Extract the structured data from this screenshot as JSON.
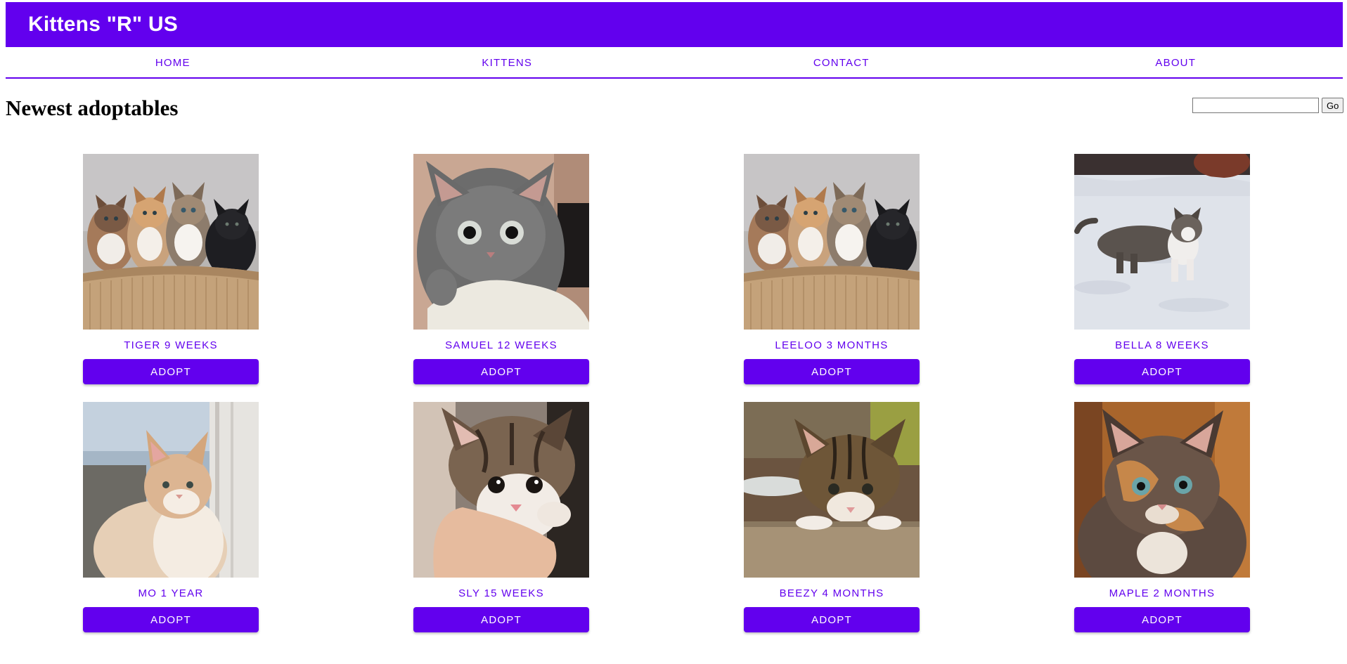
{
  "header": {
    "title": "Kittens \"R\" US",
    "color": "#6200ee"
  },
  "nav": {
    "tabs": [
      {
        "label": "HOME"
      },
      {
        "label": "KITTENS"
      },
      {
        "label": "CONTACT"
      },
      {
        "label": "ABOUT"
      }
    ]
  },
  "main": {
    "heading": "Newest adoptables"
  },
  "search": {
    "value": "",
    "placeholder": "",
    "button_label": "Go"
  },
  "kittens": [
    {
      "caption": "TIGER 9 WEEKS",
      "adopt_label": "ADOPT",
      "photo": "kittens-in-basket-photo"
    },
    {
      "caption": "SAMUEL 12 WEEKS",
      "adopt_label": "ADOPT",
      "photo": "grey-fluffy-kitten-photo"
    },
    {
      "caption": "LEELOO 3 MONTHS",
      "adopt_label": "ADOPT",
      "photo": "kittens-in-basket-photo"
    },
    {
      "caption": "BELLA 8 WEEKS",
      "adopt_label": "ADOPT",
      "photo": "kitten-in-snow-photo"
    },
    {
      "caption": "MO 1 YEAR",
      "adopt_label": "ADOPT",
      "photo": "ginger-white-cat-photo"
    },
    {
      "caption": "SLY 15 WEEKS",
      "adopt_label": "ADOPT",
      "photo": "kitten-on-hand-photo"
    },
    {
      "caption": "BEEZY 4 MONTHS",
      "adopt_label": "ADOPT",
      "photo": "tabby-kitten-on-table-photo"
    },
    {
      "caption": "MAPLE 2 MONTHS",
      "adopt_label": "ADOPT",
      "photo": "tortoiseshell-kitten-photo"
    }
  ]
}
